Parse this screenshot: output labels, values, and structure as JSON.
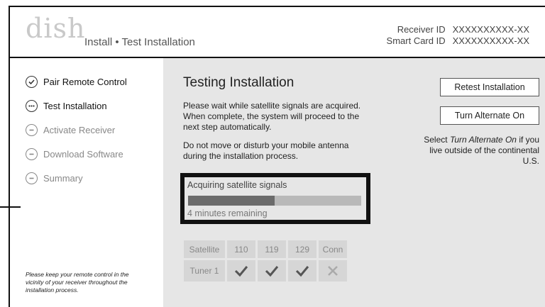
{
  "header": {
    "logo": "dish",
    "title": "Install • Test Installation",
    "receiver_id_label": "Receiver ID",
    "receiver_id_value": "XXXXXXXXXX-XX",
    "smart_card_label": "Smart Card ID",
    "smart_card_value": "XXXXXXXXXX-XX"
  },
  "steps": [
    {
      "label": "Pair Remote Control",
      "status": "done",
      "icon": "check-circle-icon"
    },
    {
      "label": "Test Installation",
      "status": "active",
      "icon": "ellipsis-circle-icon"
    },
    {
      "label": "Activate Receiver",
      "status": "pending",
      "icon": "minus-circle-icon"
    },
    {
      "label": "Download Software",
      "status": "pending",
      "icon": "minus-circle-icon"
    },
    {
      "label": "Summary",
      "status": "pending",
      "icon": "minus-circle-icon"
    }
  ],
  "sidebar_note": "Please keep your remote control in the vicinity of your receiver throughout the installation process.",
  "main": {
    "title": "Testing Installation",
    "para1": "Please wait while satellite signals are acquired.  When complete, the system will proceed to the next step automatically.",
    "para2": "Do not move or disturb your mobile antenna during the installation process.",
    "retest_button": "Retest Installation",
    "alternate_button": "Turn Alternate On",
    "hint_prefix": "Select ",
    "hint_emphasis": "Turn Alternate On",
    "hint_suffix": " if you live outside of the continental U.S."
  },
  "progress": {
    "label": "Acquiring satellite signals",
    "fraction": 0.5,
    "remaining": "4 minutes remaining"
  },
  "table": {
    "headers": [
      "Satellite",
      "110",
      "119",
      "129",
      "Conn"
    ],
    "row_label": "Tuner 1",
    "status_icons": [
      "check-icon",
      "check-icon",
      "check-icon",
      "x-icon"
    ]
  }
}
